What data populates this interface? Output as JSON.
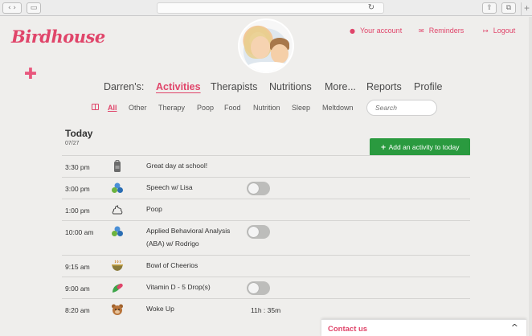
{
  "colors": {
    "brand": "#e0456a",
    "add_button": "#2a9a3f",
    "toggle_off": "#bdbdbb"
  },
  "top_links": {
    "account": "Your account",
    "reminders": "Reminders",
    "logout": "Logout"
  },
  "logo": "Birdhouse",
  "nav": {
    "owner": "Darren's:",
    "items": [
      "Activities",
      "Therapists",
      "Nutritions",
      "More...",
      "Reports",
      "Profile"
    ],
    "active": "Activities"
  },
  "filters": {
    "items": [
      "All",
      "Other",
      "Therapy",
      "Poop",
      "Food",
      "Nutrition",
      "Sleep",
      "Meltdown"
    ],
    "active": "All"
  },
  "search": {
    "placeholder": "Search"
  },
  "today": {
    "title": "Today",
    "date": "07/27",
    "add_button": "Add an activity to today"
  },
  "activities": [
    {
      "time": "3:30 pm",
      "icon": "school-bag-icon",
      "desc": "Great day at school!",
      "toggle": null,
      "duration": null
    },
    {
      "time": "3:00 pm",
      "icon": "therapy-blocks-icon",
      "desc": "Speech w/ Lisa",
      "toggle": false,
      "duration": null
    },
    {
      "time": "1:00 pm",
      "icon": "poop-icon",
      "desc": "Poop",
      "toggle": null,
      "duration": null
    },
    {
      "time": "10:00 am",
      "icon": "therapy-blocks-icon",
      "desc": "Applied Behavioral Analysis (ABA) w/ Rodrigo",
      "toggle": false,
      "duration": null
    },
    {
      "time": "9:15 am",
      "icon": "bowl-icon",
      "desc": "Bowl of Cheerios",
      "toggle": null,
      "duration": null
    },
    {
      "time": "9:00 am",
      "icon": "pill-leaf-icon",
      "desc": "Vitamin D - 5 Drop(s)",
      "toggle": false,
      "duration": null
    },
    {
      "time": "8:20 am",
      "icon": "bear-icon",
      "desc": "Woke Up",
      "toggle": null,
      "duration": "11h : 35m"
    }
  ],
  "contact": {
    "label": "Contact us"
  }
}
